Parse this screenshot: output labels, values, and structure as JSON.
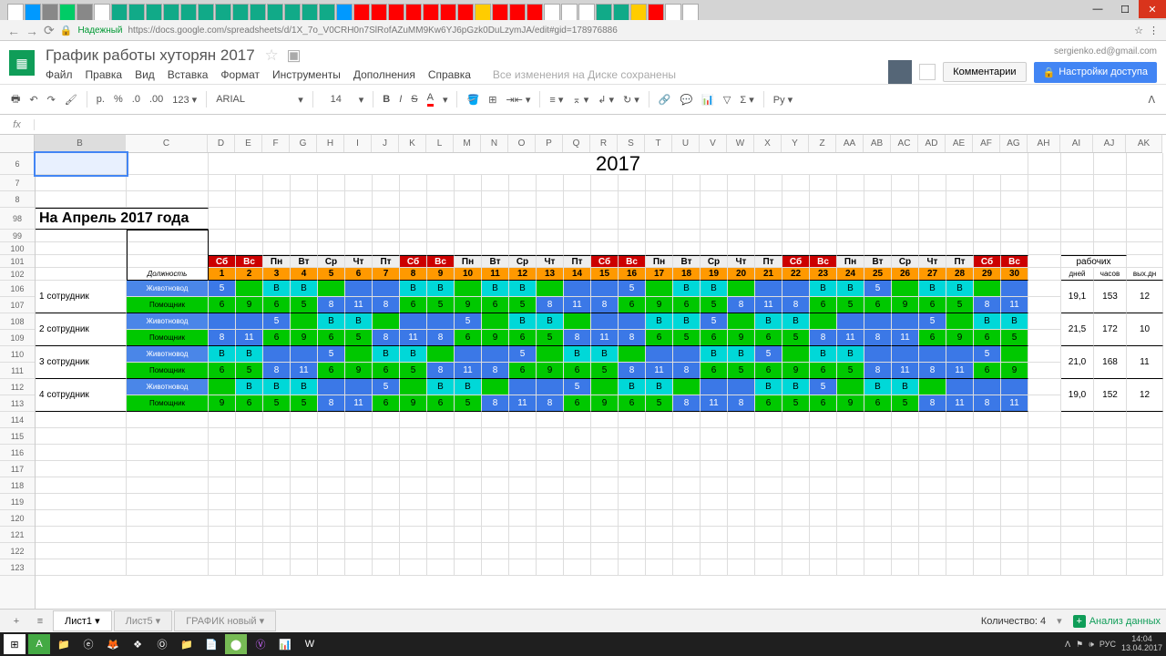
{
  "browser": {
    "secure": "Надежный",
    "url": "https://docs.google.com/spreadsheets/d/1X_7o_V0CRH0n7SlRofAZuMM9Kw6YJ6pGzk0DuLzymJA/edit#gid=178976886"
  },
  "doc": {
    "title": "График работы хуторян 2017",
    "email": "sergienko.ed@gmail.com",
    "menus": [
      "Файл",
      "Правка",
      "Вид",
      "Вставка",
      "Формат",
      "Инструменты",
      "Дополнения",
      "Справка"
    ],
    "status": "Все изменения на Диске сохранены",
    "comments": "Комментарии",
    "share": "Настройки доступа"
  },
  "toolbar": {
    "font": "ARIAL",
    "size": "14",
    "currency": "p."
  },
  "year": "2017",
  "monthTitle": "На Апрель 2017 года",
  "roleCol": "Должность",
  "dow": [
    "Сб",
    "Вс",
    "Пн",
    "Вт",
    "Ср",
    "Чт",
    "Пт",
    "Сб",
    "Вс",
    "Пн",
    "Вт",
    "Ср",
    "Чт",
    "Пт",
    "Сб",
    "Вс",
    "Пн",
    "Вт",
    "Ср",
    "Чт",
    "Пт",
    "Сб",
    "Вс",
    "Пн",
    "Вт",
    "Ср",
    "Чт",
    "Пт",
    "Сб",
    "Вс"
  ],
  "dowWeekend": [
    1,
    1,
    0,
    0,
    0,
    0,
    0,
    1,
    1,
    0,
    0,
    0,
    0,
    0,
    1,
    1,
    0,
    0,
    0,
    0,
    0,
    1,
    1,
    0,
    0,
    0,
    0,
    0,
    1,
    1
  ],
  "dates": [
    1,
    2,
    3,
    4,
    5,
    6,
    7,
    8,
    9,
    10,
    11,
    12,
    13,
    14,
    15,
    16,
    17,
    18,
    19,
    20,
    21,
    22,
    23,
    24,
    25,
    26,
    27,
    28,
    29,
    30
  ],
  "employees": [
    {
      "name": "1 сотрудник",
      "roles": [
        "Животновод",
        "Помощник"
      ]
    },
    {
      "name": "2 сотрудник",
      "roles": [
        "Животновод",
        "Помощник"
      ]
    },
    {
      "name": "3 сотрудник",
      "roles": [
        "Животновод",
        "Помощник"
      ]
    },
    {
      "name": "4 сотрудник",
      "roles": [
        "Животновод",
        "Помощник"
      ]
    }
  ],
  "schedule": [
    [
      [
        "5",
        "b"
      ],
      [
        "",
        "g"
      ],
      [
        "B",
        "c"
      ],
      [
        "B",
        "c"
      ],
      [
        "",
        "g"
      ],
      [
        "",
        "b"
      ],
      [
        "",
        "b"
      ],
      [
        "B",
        "c"
      ],
      [
        "B",
        "c"
      ],
      [
        "",
        "g"
      ],
      [
        "B",
        "c"
      ],
      [
        "B",
        "c"
      ],
      [
        "",
        "g"
      ],
      [
        "",
        "b"
      ],
      [
        "",
        "b"
      ],
      [
        "5",
        "b"
      ],
      [
        "",
        "g"
      ],
      [
        "B",
        "c"
      ],
      [
        "B",
        "c"
      ],
      [
        "",
        "g"
      ],
      [
        "",
        "b"
      ],
      [
        "",
        "b"
      ],
      [
        "B",
        "c"
      ],
      [
        "B",
        "c"
      ],
      [
        "5",
        "b"
      ],
      [
        "",
        "g"
      ],
      [
        "B",
        "c"
      ],
      [
        "B",
        "c"
      ],
      [
        "",
        "g"
      ],
      [
        "",
        "b"
      ]
    ],
    [
      [
        "6",
        "g"
      ],
      [
        "9",
        "g"
      ],
      [
        "6",
        "g"
      ],
      [
        "5",
        "g"
      ],
      [
        "8",
        "b"
      ],
      [
        "11",
        "b"
      ],
      [
        "8",
        "b"
      ],
      [
        "6",
        "g"
      ],
      [
        "5",
        "g"
      ],
      [
        "9",
        "g"
      ],
      [
        "6",
        "g"
      ],
      [
        "5",
        "g"
      ],
      [
        "8",
        "b"
      ],
      [
        "11",
        "b"
      ],
      [
        "8",
        "b"
      ],
      [
        "6",
        "g"
      ],
      [
        "9",
        "g"
      ],
      [
        "6",
        "g"
      ],
      [
        "5",
        "g"
      ],
      [
        "8",
        "b"
      ],
      [
        "11",
        "b"
      ],
      [
        "8",
        "b"
      ],
      [
        "6",
        "g"
      ],
      [
        "5",
        "g"
      ],
      [
        "6",
        "g"
      ],
      [
        "9",
        "g"
      ],
      [
        "6",
        "g"
      ],
      [
        "5",
        "g"
      ],
      [
        "8",
        "b"
      ],
      [
        "11",
        "b"
      ]
    ],
    [
      [
        "",
        "b"
      ],
      [
        "",
        "b"
      ],
      [
        "5",
        "b"
      ],
      [
        "",
        "g"
      ],
      [
        "B",
        "c"
      ],
      [
        "B",
        "c"
      ],
      [
        "",
        "g"
      ],
      [
        "",
        "b"
      ],
      [
        "",
        "b"
      ],
      [
        "5",
        "b"
      ],
      [
        "",
        "g"
      ],
      [
        "B",
        "c"
      ],
      [
        "B",
        "c"
      ],
      [
        "",
        "g"
      ],
      [
        "",
        "b"
      ],
      [
        "",
        "b"
      ],
      [
        "B",
        "c"
      ],
      [
        "B",
        "c"
      ],
      [
        "5",
        "b"
      ],
      [
        "",
        "g"
      ],
      [
        "B",
        "c"
      ],
      [
        "B",
        "c"
      ],
      [
        "",
        "g"
      ],
      [
        "",
        "b"
      ],
      [
        "",
        "b"
      ],
      [
        "",
        "b"
      ],
      [
        "5",
        "b"
      ],
      [
        "",
        "g"
      ],
      [
        "B",
        "c"
      ],
      [
        "B",
        "c"
      ]
    ],
    [
      [
        "8",
        "b"
      ],
      [
        "11",
        "b"
      ],
      [
        "6",
        "g"
      ],
      [
        "9",
        "g"
      ],
      [
        "6",
        "g"
      ],
      [
        "5",
        "g"
      ],
      [
        "8",
        "b"
      ],
      [
        "11",
        "b"
      ],
      [
        "8",
        "b"
      ],
      [
        "6",
        "g"
      ],
      [
        "9",
        "g"
      ],
      [
        "6",
        "g"
      ],
      [
        "5",
        "g"
      ],
      [
        "8",
        "b"
      ],
      [
        "11",
        "b"
      ],
      [
        "8",
        "b"
      ],
      [
        "6",
        "g"
      ],
      [
        "5",
        "g"
      ],
      [
        "6",
        "g"
      ],
      [
        "9",
        "g"
      ],
      [
        "6",
        "g"
      ],
      [
        "5",
        "g"
      ],
      [
        "8",
        "b"
      ],
      [
        "11",
        "b"
      ],
      [
        "8",
        "b"
      ],
      [
        "11",
        "b"
      ],
      [
        "6",
        "g"
      ],
      [
        "9",
        "g"
      ],
      [
        "6",
        "g"
      ],
      [
        "5",
        "g"
      ]
    ],
    [
      [
        "B",
        "c"
      ],
      [
        "B",
        "c"
      ],
      [
        "",
        "b"
      ],
      [
        "",
        "b"
      ],
      [
        "5",
        "b"
      ],
      [
        "",
        "g"
      ],
      [
        "B",
        "c"
      ],
      [
        "B",
        "c"
      ],
      [
        "",
        "g"
      ],
      [
        "",
        "b"
      ],
      [
        "",
        "b"
      ],
      [
        "5",
        "b"
      ],
      [
        "",
        "g"
      ],
      [
        "B",
        "c"
      ],
      [
        "B",
        "c"
      ],
      [
        "",
        "g"
      ],
      [
        "",
        "b"
      ],
      [
        "",
        "b"
      ],
      [
        "B",
        "c"
      ],
      [
        "B",
        "c"
      ],
      [
        "5",
        "b"
      ],
      [
        "",
        "g"
      ],
      [
        "B",
        "c"
      ],
      [
        "B",
        "c"
      ],
      [
        "",
        "b"
      ],
      [
        "",
        "b"
      ],
      [
        "",
        "b"
      ],
      [
        "",
        "b"
      ],
      [
        "5",
        "b"
      ],
      [
        "",
        "g"
      ]
    ],
    [
      [
        "6",
        "g"
      ],
      [
        "5",
        "g"
      ],
      [
        "8",
        "b"
      ],
      [
        "11",
        "b"
      ],
      [
        "6",
        "g"
      ],
      [
        "9",
        "g"
      ],
      [
        "6",
        "g"
      ],
      [
        "5",
        "g"
      ],
      [
        "8",
        "b"
      ],
      [
        "11",
        "b"
      ],
      [
        "8",
        "b"
      ],
      [
        "6",
        "g"
      ],
      [
        "9",
        "g"
      ],
      [
        "6",
        "g"
      ],
      [
        "5",
        "g"
      ],
      [
        "8",
        "b"
      ],
      [
        "11",
        "b"
      ],
      [
        "8",
        "b"
      ],
      [
        "6",
        "g"
      ],
      [
        "5",
        "g"
      ],
      [
        "6",
        "g"
      ],
      [
        "9",
        "g"
      ],
      [
        "6",
        "g"
      ],
      [
        "5",
        "g"
      ],
      [
        "8",
        "b"
      ],
      [
        "11",
        "b"
      ],
      [
        "8",
        "b"
      ],
      [
        "11",
        "b"
      ],
      [
        "6",
        "g"
      ],
      [
        "9",
        "g"
      ]
    ],
    [
      [
        "",
        "g"
      ],
      [
        "B",
        "c"
      ],
      [
        "B",
        "c"
      ],
      [
        "B",
        "c"
      ],
      [
        "",
        "b"
      ],
      [
        "",
        "b"
      ],
      [
        "5",
        "b"
      ],
      [
        "",
        "g"
      ],
      [
        "B",
        "c"
      ],
      [
        "B",
        "c"
      ],
      [
        "",
        "g"
      ],
      [
        "",
        "b"
      ],
      [
        "",
        "b"
      ],
      [
        "5",
        "b"
      ],
      [
        "",
        "g"
      ],
      [
        "B",
        "c"
      ],
      [
        "B",
        "c"
      ],
      [
        "",
        "g"
      ],
      [
        "",
        "b"
      ],
      [
        "",
        "b"
      ],
      [
        "B",
        "c"
      ],
      [
        "B",
        "c"
      ],
      [
        "5",
        "b"
      ],
      [
        "",
        "g"
      ],
      [
        "B",
        "c"
      ],
      [
        "B",
        "c"
      ],
      [
        "",
        "g"
      ],
      [
        "",
        "b"
      ],
      [
        "",
        "b"
      ],
      [
        "",
        "b"
      ]
    ],
    [
      [
        "9",
        "g"
      ],
      [
        "6",
        "g"
      ],
      [
        "5",
        "g"
      ],
      [
        "5",
        "g"
      ],
      [
        "8",
        "b"
      ],
      [
        "11",
        "b"
      ],
      [
        "6",
        "g"
      ],
      [
        "9",
        "g"
      ],
      [
        "6",
        "g"
      ],
      [
        "5",
        "g"
      ],
      [
        "8",
        "b"
      ],
      [
        "11",
        "b"
      ],
      [
        "8",
        "b"
      ],
      [
        "6",
        "g"
      ],
      [
        "9",
        "g"
      ],
      [
        "6",
        "g"
      ],
      [
        "5",
        "g"
      ],
      [
        "8",
        "b"
      ],
      [
        "11",
        "b"
      ],
      [
        "8",
        "b"
      ],
      [
        "6",
        "g"
      ],
      [
        "5",
        "g"
      ],
      [
        "6",
        "g"
      ],
      [
        "9",
        "g"
      ],
      [
        "6",
        "g"
      ],
      [
        "5",
        "g"
      ],
      [
        "8",
        "b"
      ],
      [
        "11",
        "b"
      ],
      [
        "8",
        "b"
      ],
      [
        "11",
        "b"
      ]
    ]
  ],
  "sumHeaders": {
    "group": "рабочих",
    "d": "дней",
    "h": "часов",
    "o": "вых.дн"
  },
  "sums": [
    {
      "d": "19,1",
      "h": "153",
      "o": "12"
    },
    {
      "d": "21,5",
      "h": "172",
      "o": "10"
    },
    {
      "d": "21,0",
      "h": "168",
      "o": "11"
    },
    {
      "d": "19,0",
      "h": "152",
      "o": "12"
    }
  ],
  "cols": [
    "B",
    "C",
    "D",
    "E",
    "F",
    "G",
    "H",
    "I",
    "J",
    "K",
    "L",
    "M",
    "N",
    "O",
    "P",
    "Q",
    "R",
    "S",
    "T",
    "U",
    "V",
    "W",
    "X",
    "Y",
    "Z",
    "AA",
    "AB",
    "AC",
    "AD",
    "AE",
    "AF",
    "AG",
    "AH",
    "AI",
    "AJ",
    "AK"
  ],
  "rows": [
    "6",
    "7",
    "8",
    "98",
    "99",
    "100",
    "101",
    "102",
    "106",
    "107",
    "108",
    "109",
    "110",
    "111",
    "112",
    "113",
    "114",
    "115",
    "116",
    "117",
    "118",
    "119",
    "120",
    "121",
    "122",
    "123"
  ],
  "sheetTabs": [
    "Лист1",
    "Лист5",
    "ГРАФИК новый"
  ],
  "footer": {
    "count": "Количество: 4",
    "analyze": "Анализ данных"
  },
  "tray": {
    "lang": "РУС",
    "time": "14:04",
    "date": "13.04.2017"
  }
}
